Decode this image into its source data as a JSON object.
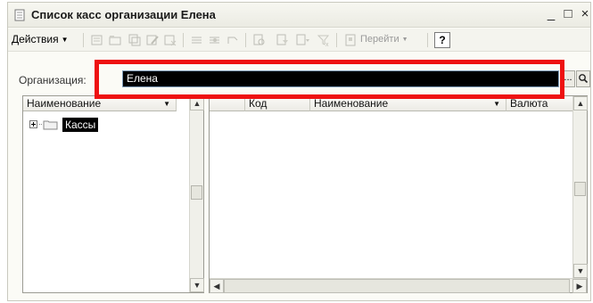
{
  "window": {
    "title": "Список касс организации Елена",
    "minimize": "_",
    "maximize": "□",
    "close": "×"
  },
  "toolbar": {
    "actions_label": "Действия",
    "goto_label": "Перейти",
    "help_label": "?"
  },
  "organization": {
    "label": "Организация:",
    "value": "Елена",
    "select_label": "..."
  },
  "tree": {
    "header": "Наименование",
    "items": [
      {
        "label": "Кассы",
        "expander": "⊞"
      }
    ]
  },
  "table": {
    "columns": [
      "Код",
      "Наименование",
      "Валюта"
    ]
  },
  "colors": {
    "highlight": "#ee1111",
    "selection": "#000000"
  }
}
